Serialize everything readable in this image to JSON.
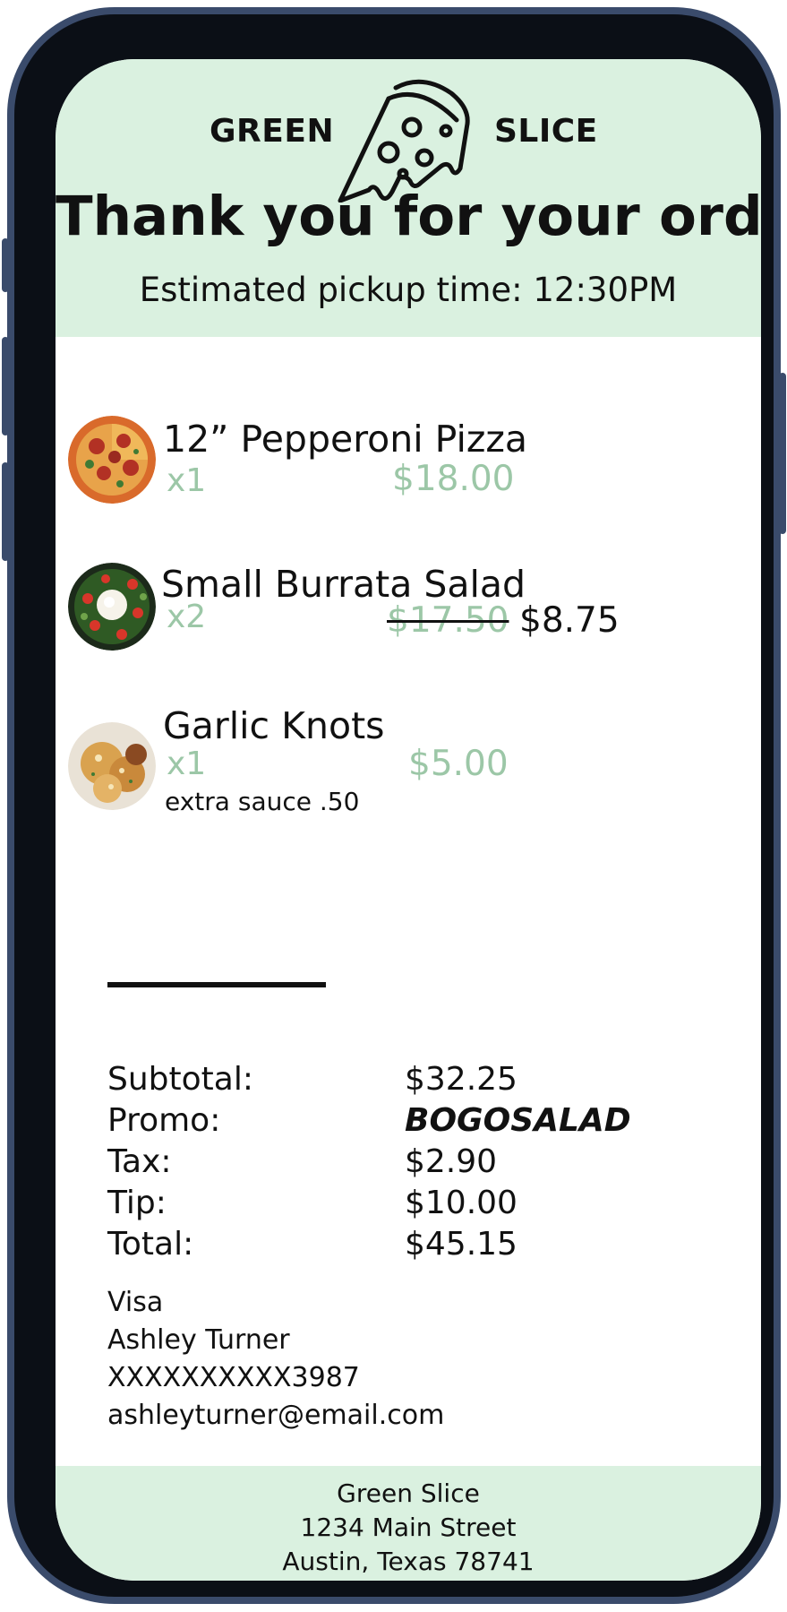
{
  "brand": {
    "left": "GREEN",
    "right": "SLICE",
    "logo_icon": "pizza-slice-icon"
  },
  "header": {
    "title": "Thank you for your order",
    "pickup": "Estimated pickup time: 12:30PM"
  },
  "items": [
    {
      "name": "12” Pepperoni Pizza",
      "qty": "x1",
      "price": "$18.00",
      "icon": "pizza-photo"
    },
    {
      "name": "Small Burrata Salad",
      "qty": "x2",
      "original_price": "$17.50",
      "discounted_price": "$8.75",
      "icon": "salad-photo"
    },
    {
      "name": "Garlic Knots",
      "qty": "x1",
      "price": "$5.00",
      "modifier": "extra sauce .50",
      "icon": "garlic-knots-photo"
    }
  ],
  "summary": {
    "subtotal_label": "Subtotal:",
    "subtotal": "$32.25",
    "promo_label": "Promo:",
    "promo": "BOGOSALAD",
    "tax_label": "Tax:",
    "tax": "$2.90",
    "tip_label": "Tip:",
    "tip": "$10.00",
    "total_label": "Total:",
    "total": "$45.15"
  },
  "payment": {
    "card_type": "Visa",
    "name": "Ashley Turner",
    "card_number": "XXXXXXXXXX3987",
    "email": "ashleyturner@email.com"
  },
  "footer": {
    "name": "Green Slice",
    "street": "1234 Main Street",
    "city": "Austin, Texas 78741"
  },
  "colors": {
    "header_bg": "#daf1e0",
    "accent_green": "#9cc7a7",
    "frame": "#3a4b6b"
  }
}
